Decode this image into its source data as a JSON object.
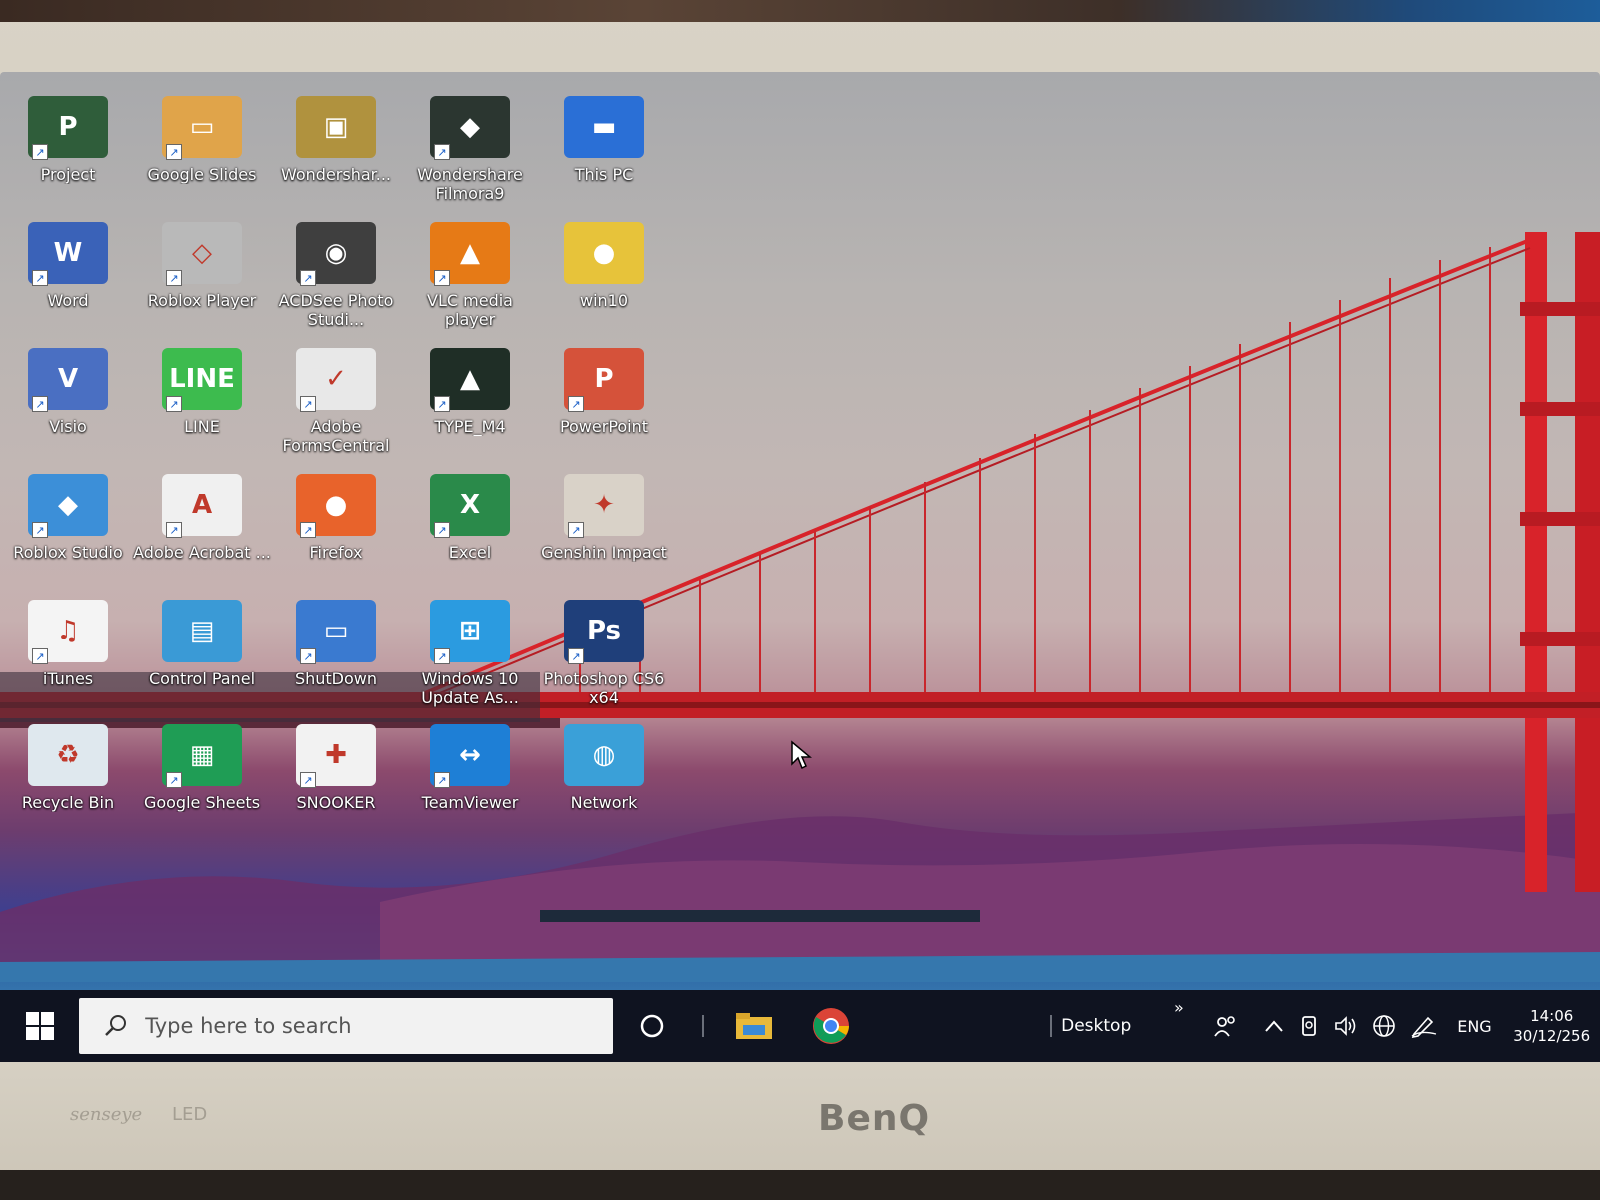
{
  "desktop": {
    "icons": [
      {
        "label": "Project",
        "glyph": "P",
        "color": "#2f5d3a",
        "icon_name": "project-icon",
        "shortcut": true
      },
      {
        "label": "Google Slides",
        "glyph": "▭",
        "color": "#e0a44a",
        "icon_name": "google-slides-icon",
        "shortcut": true
      },
      {
        "label": "Wondershar...",
        "glyph": "▣",
        "color": "#b0923e",
        "icon_name": "wondershare-folder-icon",
        "shortcut": false
      },
      {
        "label": "Wondershare Filmora9",
        "glyph": "◆",
        "color": "#2b3630",
        "icon_name": "filmora-icon",
        "shortcut": true
      },
      {
        "label": "This PC",
        "glyph": "▬",
        "color": "#2a6fd6",
        "icon_name": "this-pc-icon",
        "shortcut": false
      },
      {
        "label": "Word",
        "glyph": "W",
        "color": "#3a62b8",
        "icon_name": "word-icon",
        "shortcut": true
      },
      {
        "label": "Roblox Player",
        "glyph": "◇",
        "color": "#b9b9b9",
        "icon_name": "roblox-player-icon",
        "shortcut": true
      },
      {
        "label": "ACDSee Photo Studi...",
        "glyph": "◉",
        "color": "#3f3f3f",
        "icon_name": "acdsee-icon",
        "shortcut": true
      },
      {
        "label": "VLC media player",
        "glyph": "▲",
        "color": "#e67a16",
        "icon_name": "vlc-icon",
        "shortcut": true
      },
      {
        "label": "win10",
        "glyph": "●",
        "color": "#e7c33a",
        "icon_name": "win10-folder-icon",
        "shortcut": false
      },
      {
        "label": "Visio",
        "glyph": "V",
        "color": "#4a6fc2",
        "icon_name": "visio-icon",
        "shortcut": true
      },
      {
        "label": "LINE",
        "glyph": "LINE",
        "color": "#3dbb4e",
        "icon_name": "line-icon",
        "shortcut": true
      },
      {
        "label": "Adobe FormsCentral",
        "glyph": "✓",
        "color": "#e8e8e8",
        "icon_name": "adobe-formscentral-icon",
        "shortcut": true
      },
      {
        "label": "TYPE_M4",
        "glyph": "▲",
        "color": "#1f2e26",
        "icon_name": "type-m4-icon",
        "shortcut": true
      },
      {
        "label": "PowerPoint",
        "glyph": "P",
        "color": "#d5523a",
        "icon_name": "powerpoint-icon",
        "shortcut": true
      },
      {
        "label": "Roblox Studio",
        "glyph": "◆",
        "color": "#3c8fd8",
        "icon_name": "roblox-studio-icon",
        "shortcut": true
      },
      {
        "label": "Adobe Acrobat ...",
        "glyph": "A",
        "color": "#f0f0f0",
        "icon_name": "adobe-acrobat-icon",
        "shortcut": true
      },
      {
        "label": "Firefox",
        "glyph": "●",
        "color": "#e8632b",
        "icon_name": "firefox-icon",
        "shortcut": true
      },
      {
        "label": "Excel",
        "glyph": "X",
        "color": "#2a8a4a",
        "icon_name": "excel-icon",
        "shortcut": true
      },
      {
        "label": "Genshin Impact",
        "glyph": "✦",
        "color": "#d9d2c8",
        "icon_name": "genshin-impact-icon",
        "shortcut": true
      },
      {
        "label": "iTunes",
        "glyph": "♫",
        "color": "#f4f4f4",
        "icon_name": "itunes-icon",
        "shortcut": true
      },
      {
        "label": "Control Panel",
        "glyph": "▤",
        "color": "#3a9ad6",
        "icon_name": "control-panel-icon",
        "shortcut": false
      },
      {
        "label": "ShutDown",
        "glyph": "▭",
        "color": "#3a7ad0",
        "icon_name": "shutdown-icon",
        "shortcut": true
      },
      {
        "label": "Windows 10 Update As...",
        "glyph": "⊞",
        "color": "#2b9be0",
        "icon_name": "windows-update-assistant-icon",
        "shortcut": true
      },
      {
        "label": "Photoshop CS6 x64",
        "glyph": "Ps",
        "color": "#1f3f7a",
        "icon_name": "photoshop-icon",
        "shortcut": true
      },
      {
        "label": "Recycle Bin",
        "glyph": "♻",
        "color": "#dfe8ee",
        "icon_name": "recycle-bin-icon",
        "shortcut": false
      },
      {
        "label": "Google Sheets",
        "glyph": "▦",
        "color": "#1f9d55",
        "icon_name": "google-sheets-icon",
        "shortcut": true
      },
      {
        "label": "SNOOKER",
        "glyph": "✚",
        "color": "#f2f2f2",
        "icon_name": "snooker-icon",
        "shortcut": true
      },
      {
        "label": "TeamViewer",
        "glyph": "↔",
        "color": "#1e7fd6",
        "icon_name": "teamviewer-icon",
        "shortcut": true
      },
      {
        "label": "Network",
        "glyph": "◍",
        "color": "#3aa0d8",
        "icon_name": "network-icon",
        "shortcut": false
      }
    ]
  },
  "taskbar": {
    "search_placeholder": "Type here to search",
    "toolbar_label": "Desktop",
    "toolbar_chevron": "»",
    "language": "ENG",
    "time": "14:06",
    "date": "30/12/256",
    "pinned": [
      {
        "name": "file-explorer",
        "icon_name": "file-explorer-icon",
        "color": "#e8b93a"
      },
      {
        "name": "chrome",
        "icon_name": "chrome-icon",
        "color": "#db4437"
      }
    ]
  },
  "monitor": {
    "brand": "BenQ",
    "sub_brand": "senseye",
    "led_mark": "LED"
  },
  "colors": {
    "bridge": "#d8232a",
    "taskbar": "#0f1320",
    "accent": "#2b7ad6"
  }
}
